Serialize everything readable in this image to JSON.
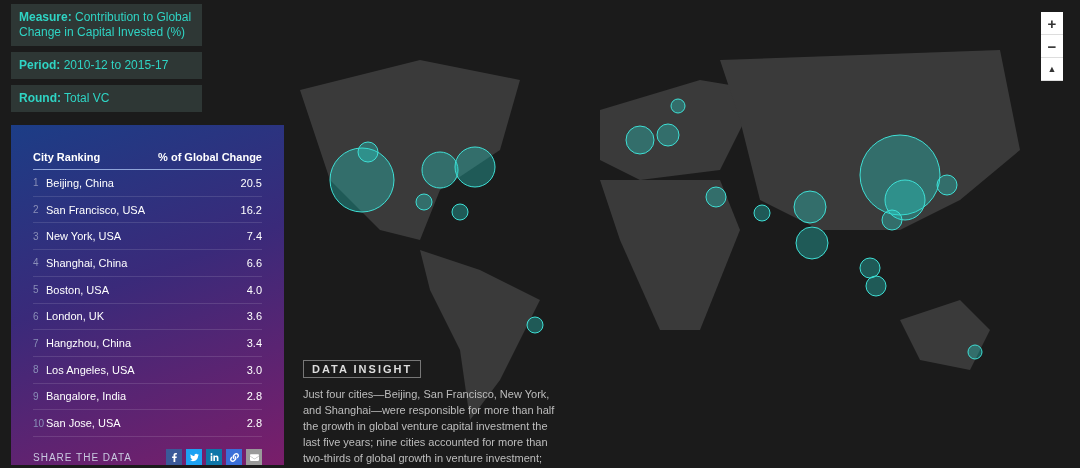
{
  "filters": [
    {
      "label": "Measure:",
      "value": "Contribution to Global Change in Capital Invested (%)"
    },
    {
      "label": "Period:",
      "value": "2010-12 to 2015-17"
    },
    {
      "label": "Round:",
      "value": "Total VC"
    }
  ],
  "ranking": {
    "columns": [
      "City Ranking",
      "% of Global Change"
    ],
    "rows": [
      {
        "rank": "1",
        "city": "Beijing, China",
        "value": "20.5"
      },
      {
        "rank": "2",
        "city": "San Francisco, USA",
        "value": "16.2"
      },
      {
        "rank": "3",
        "city": "New York, USA",
        "value": "7.4"
      },
      {
        "rank": "4",
        "city": "Shanghai, China",
        "value": "6.6"
      },
      {
        "rank": "5",
        "city": "Boston, USA",
        "value": "4.0"
      },
      {
        "rank": "6",
        "city": "London, UK",
        "value": "3.6"
      },
      {
        "rank": "7",
        "city": "Hangzhou, China",
        "value": "3.4"
      },
      {
        "rank": "8",
        "city": "Los Angeles, USA",
        "value": "3.0"
      },
      {
        "rank": "9",
        "city": "Bangalore, India",
        "value": "2.8"
      },
      {
        "rank": "10",
        "city": "San Jose, USA",
        "value": "2.8"
      }
    ],
    "share": {
      "label": "SHARE THE DATA",
      "buttons": [
        {
          "kind": "facebook",
          "color": "#3b5998"
        },
        {
          "kind": "twitter",
          "color": "#1da1f2"
        },
        {
          "kind": "linkedin",
          "color": "#0e76a8"
        },
        {
          "kind": "link",
          "color": "#3a6fd8"
        },
        {
          "kind": "email",
          "color": "#9a9a9a"
        }
      ]
    }
  },
  "insight": {
    "title": "DATA INSIGHT",
    "text": "Just four cities—Beijing, San Francisco, New York, and Shanghai—were responsible for more than half the growth in global venture capital investment the last five years; nine cities accounted for more than two-thirds of global growth in venture investment;"
  },
  "map_controls": [
    {
      "kind": "zoom-in",
      "label": "+"
    },
    {
      "kind": "zoom-out",
      "label": "−"
    },
    {
      "kind": "compass",
      "label": "▲"
    }
  ]
}
